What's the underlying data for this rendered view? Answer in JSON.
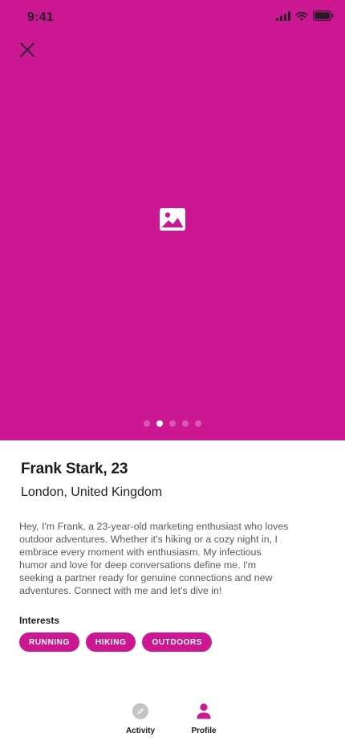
{
  "status_bar": {
    "time": "9:41"
  },
  "header": {
    "close_icon": "close-icon"
  },
  "hero": {
    "background_color": "#cc1793",
    "placeholder_icon": "image-icon",
    "carousel": {
      "total": 5,
      "active_index": 1
    }
  },
  "profile": {
    "name_age": "Frank Stark, 23",
    "location": "London, United Kingdom",
    "bio": "Hey, I'm Frank, a 23-year-old marketing enthusiast who loves outdoor adventures. Whether it's hiking or a cozy night in, I embrace every moment with enthusiasm. My infectious humor and love for deep conversations define me. I'm seeking a partner ready for genuine connections and new adventures. Connect with me and let's dive in!",
    "interests_heading": "Interests",
    "interests": [
      "RUNNING",
      "HIKING",
      "OUTDOORS"
    ]
  },
  "tabbar": {
    "tabs": [
      {
        "label": "Activity",
        "icon": "compass-icon",
        "active": false
      },
      {
        "label": "Profile",
        "icon": "person-icon",
        "active": true
      }
    ]
  },
  "colors": {
    "accent": "#cc1793",
    "inactive_icon": "#c4c4c4",
    "text_primary": "#1b1b1b",
    "text_secondary": "#5a5a5a"
  }
}
